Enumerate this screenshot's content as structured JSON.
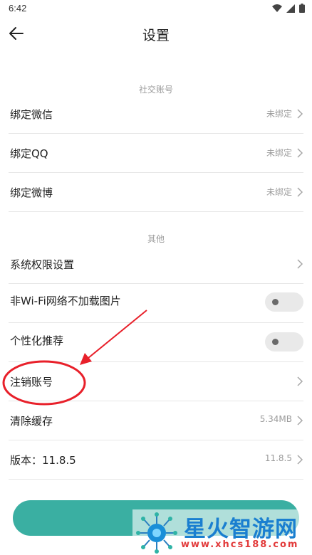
{
  "status_bar": {
    "time": "6:42"
  },
  "header": {
    "title": "设置"
  },
  "sections": {
    "social": "社交账号",
    "other": "其他"
  },
  "social_items": [
    {
      "label": "绑定微信",
      "value": "未绑定"
    },
    {
      "label": "绑定QQ",
      "value": "未绑定"
    },
    {
      "label": "绑定微博",
      "value": "未绑定"
    }
  ],
  "other_items": [
    {
      "label": "系统权限设置"
    },
    {
      "label": "非Wi-Fi网络不加载图片",
      "toggle": false
    },
    {
      "label": "个性化推荐",
      "toggle": false
    },
    {
      "label": "注销账号"
    },
    {
      "label": "清除缓存",
      "value": "5.34MB"
    },
    {
      "label": "版本：11.8.5",
      "value": "11.8.5"
    }
  ],
  "colors": {
    "accent": "#3aafa2",
    "annotation": "#e8202a",
    "watermark_blue": "#1a7fd0"
  },
  "watermark": {
    "title": "星火智游网",
    "url": "www.xhcs188.com"
  }
}
